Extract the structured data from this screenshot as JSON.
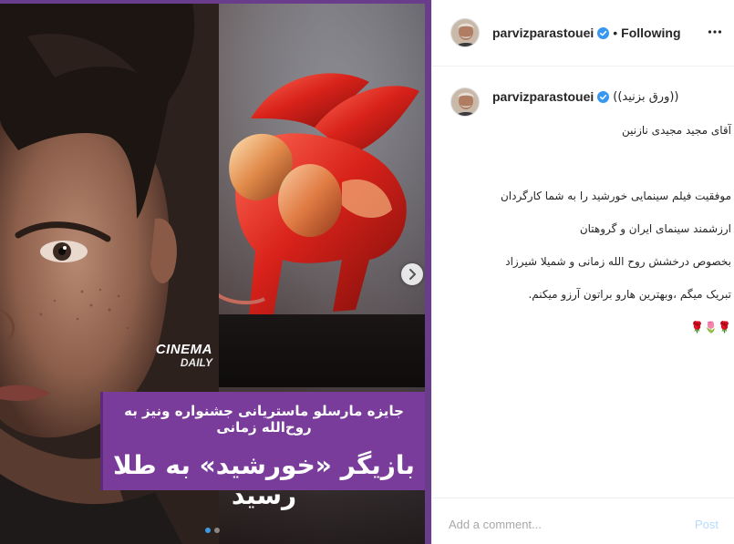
{
  "media": {
    "logo_line1": "CINEMA",
    "logo_line2": "DAILY",
    "headline_line1": "جایزه مارسلو ماستریانی جشنواره ونیز به روح‌الله زمانی",
    "headline_line2": "بازیگر «خورشید» به طلا رسید",
    "next_icon": "chevron-right-icon",
    "carousel": {
      "count": 2,
      "active": 1
    }
  },
  "header": {
    "username": "parvizparastouei",
    "verified_icon": "verified-badge-icon",
    "separator": "•",
    "follow_label": "Following",
    "more_icon": "more-horizontal-icon"
  },
  "caption": {
    "username": "parvizparastouei",
    "tag": "((ورق بزنید))",
    "lines": [
      "آقای مجید مجیدی نازنین",
      "",
      "موفقیت فیلم سینمایی خورشید را به شما کارگردان",
      "ارزشمند سینمای ایران و گروهتان",
      "بخصوص درخشش روح الله زمانی و شمیلا شیرزاد",
      "تبریک میگم ،وبهترین هارو براتون آرزو میکنم.",
      "🌹🌷🌹"
    ]
  },
  "comment": {
    "placeholder": "Add a comment...",
    "post_label": "Post"
  },
  "colors": {
    "headline_bg": "#7a3c9a",
    "link_blue": "#b3dbff",
    "verified_blue": "#3897f0"
  }
}
